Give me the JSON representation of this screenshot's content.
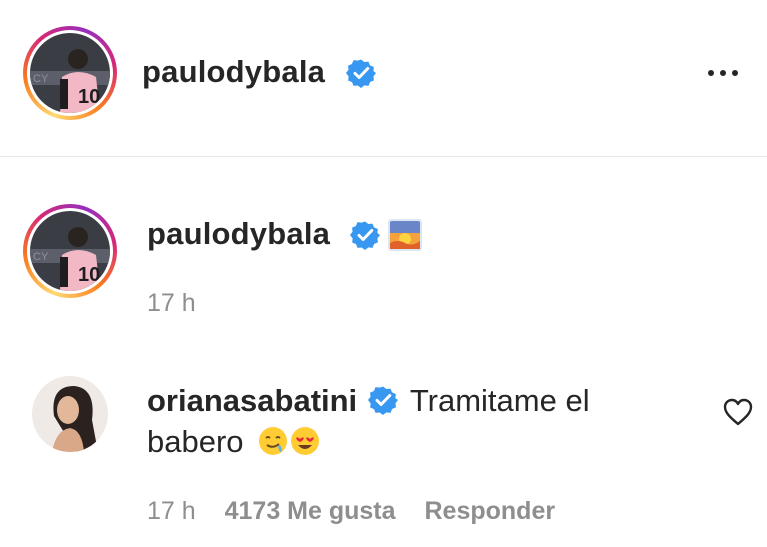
{
  "header": {
    "username": "paulodybala",
    "avatar": "avatar-paulodybala",
    "verified_icon": "verified-badge-icon",
    "more_icon": "more-options-icon",
    "jersey_number": "10"
  },
  "caption": {
    "username": "paulodybala",
    "verified_icon": "verified-badge-icon",
    "emoji_icon": "sunrise-emoji",
    "time": "17 h",
    "jersey_number": "10"
  },
  "comment": {
    "username": "orianasabatini",
    "verified_icon": "verified-badge-icon",
    "text_line1": "Tramitame el",
    "text_line2": "babero",
    "emojis": [
      "drooling-face-emoji",
      "heart-eyes-emoji"
    ],
    "time": "17 h",
    "likes": "4173 Me gusta",
    "reply": "Responder",
    "like_icon": "heart-outline-icon"
  },
  "colors": {
    "verified_blue": "#3897f0",
    "text_primary": "#262626",
    "text_secondary": "#8e8e8e"
  }
}
